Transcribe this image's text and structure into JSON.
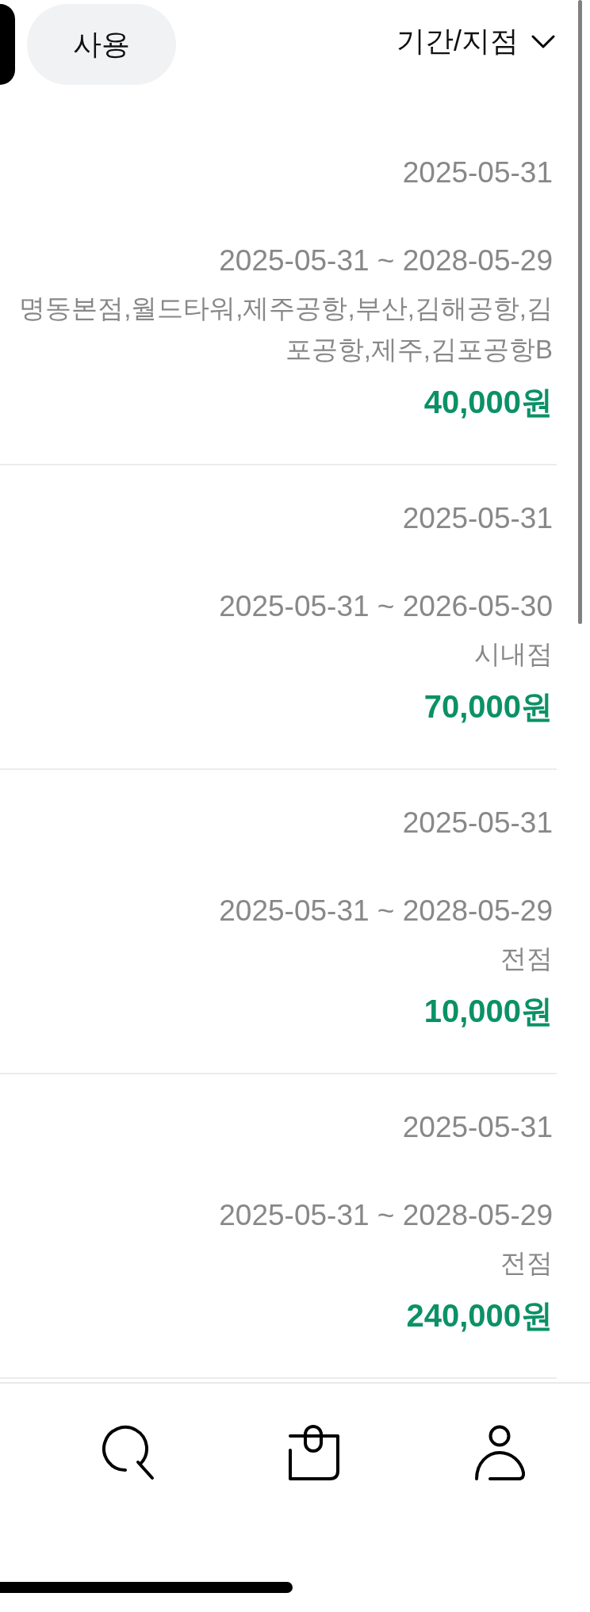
{
  "filter_bar": {
    "chips": [
      {
        "selected": true
      },
      {
        "label": "사용",
        "selected": false
      }
    ],
    "period_filter": {
      "label": "기간/지점"
    }
  },
  "vouchers": [
    {
      "issued_date": "2025-05-31",
      "valid_period": "2025-05-31 ~ 2028-05-29",
      "stores": "명동본점,월드타워,제주공항,부산,김해공항,김포공항,제주,김포공항B",
      "amount": "40,000원"
    },
    {
      "issued_date": "2025-05-31",
      "valid_period": "2025-05-31 ~ 2026-05-30",
      "stores": "시내점",
      "amount": "70,000원"
    },
    {
      "issued_date": "2025-05-31",
      "valid_period": "2025-05-31 ~ 2028-05-29",
      "stores": "전점",
      "amount": "10,000원"
    },
    {
      "issued_date": "2025-05-31",
      "valid_period": "2025-05-31 ~ 2028-05-29",
      "stores": "전점",
      "amount": "240,000원"
    }
  ],
  "bottom_nav": {
    "items": [
      {
        "kind": "search"
      },
      {
        "kind": "bag"
      },
      {
        "kind": "profile"
      }
    ]
  }
}
